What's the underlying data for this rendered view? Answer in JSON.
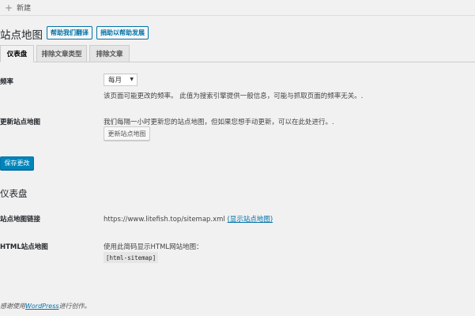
{
  "admin_bar": {
    "new_label": "新建"
  },
  "header": {
    "title": "站点地图",
    "help_translate": "帮助我们翻译",
    "donate": "捐助以帮助发展"
  },
  "tabs": [
    {
      "label": "仪表盘",
      "active": true
    },
    {
      "label": "排除文章类型",
      "active": false
    },
    {
      "label": "排除文章",
      "active": false
    }
  ],
  "settings": {
    "frequency": {
      "label": "频率",
      "selected": "每月",
      "description": "该页面可能更改的频率。 此值为搜索引擎提供一般信息，可能与抓取页面的频率无关。."
    },
    "update_sitemap": {
      "label": "更新站点地图",
      "description": "我们每隔一小时更新您的站点地图，但如果您想手动更新，可以在此处进行。.",
      "button": "更新站点地图"
    },
    "save_button": "保存更改"
  },
  "dashboard": {
    "title": "仪表盘",
    "sitemap_link": {
      "label": "站点地图链接",
      "url": "https://www.litefish.top/sitemap.xml",
      "view_link": "(显示站点地图)"
    },
    "html_sitemap": {
      "label": "HTML站点地图",
      "description": "使用此简码显示HTML网站地图：",
      "shortcode": "[html-sitemap]"
    }
  },
  "footer": {
    "prefix": "感谢使用",
    "wordpress": "WordPress",
    "suffix": "进行创作。"
  },
  "colors": {
    "primary": "#0085ba",
    "link": "#0073aa",
    "background": "#f1f1f1"
  }
}
